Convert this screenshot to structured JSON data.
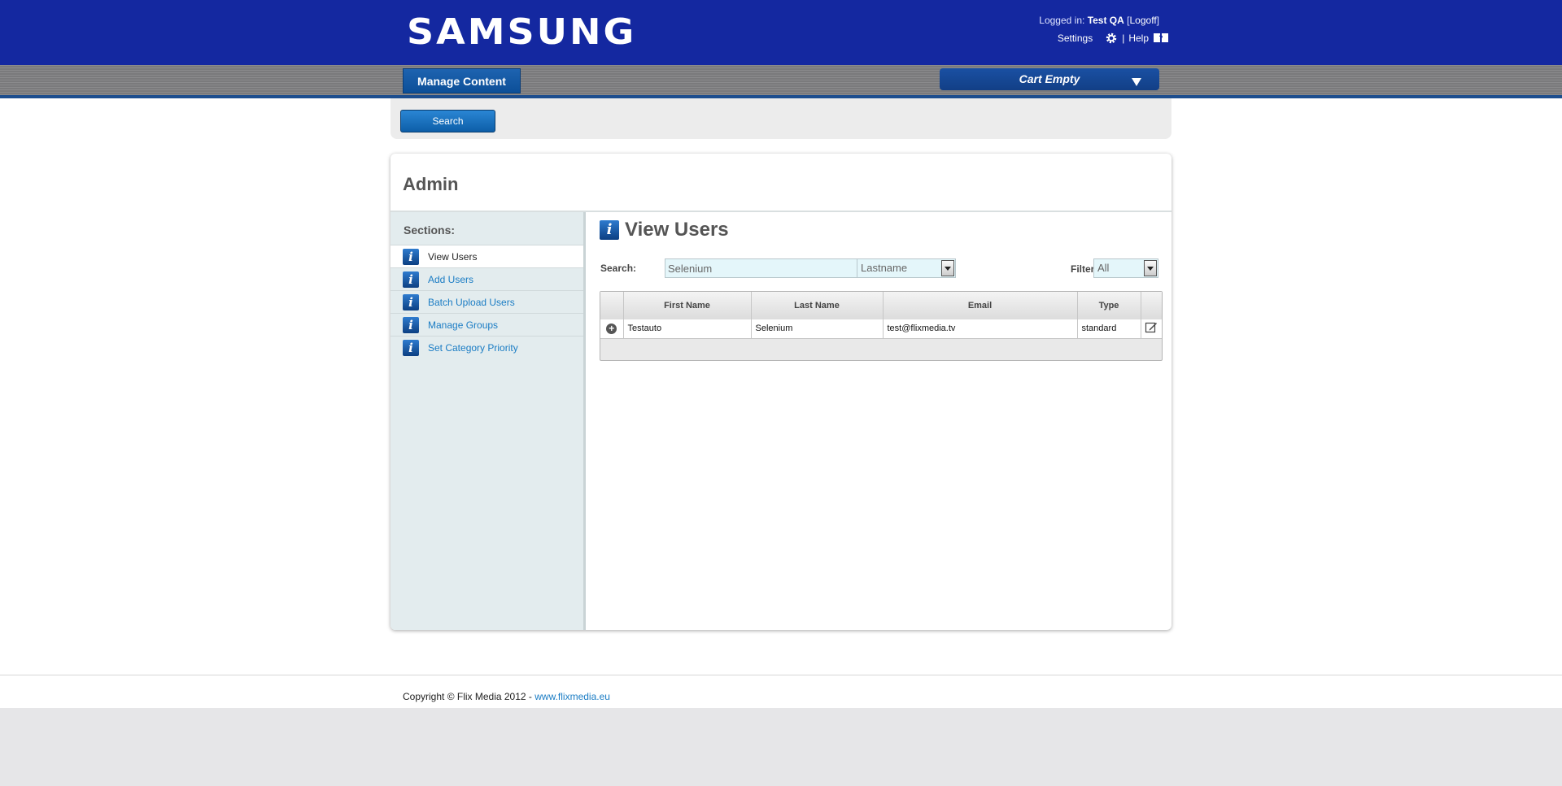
{
  "header": {
    "logo_text": "SAMSUNG",
    "logged_in_prefix": "Logged in:",
    "user_name": "Test QA",
    "logoff_label": "Logoff",
    "settings_label": "Settings",
    "help_label": "Help",
    "brand_color": "#1428a0"
  },
  "nav": {
    "manage_content_label": "Manage Content",
    "cart_label": "Cart Empty"
  },
  "toolbar": {
    "search_button_label": "Search"
  },
  "admin": {
    "title": "Admin",
    "sections_label": "Sections:",
    "sections": [
      {
        "label": "View Users",
        "active": true
      },
      {
        "label": "Add Users",
        "active": false
      },
      {
        "label": "Batch Upload Users",
        "active": false
      },
      {
        "label": "Manage Groups",
        "active": false
      },
      {
        "label": "Set Category Priority",
        "active": false
      }
    ]
  },
  "view_users": {
    "title": "View Users",
    "search_label": "Search:",
    "search_value": "Selenium",
    "search_field_select": "Lastname",
    "filter_label": "Filter",
    "filter_value": "All",
    "columns": [
      "First Name",
      "Last Name",
      "Email",
      "Type"
    ],
    "rows": [
      {
        "first_name": "Testauto",
        "last_name": "Selenium",
        "email": "test@flixmedia.tv",
        "type": "standard"
      }
    ]
  },
  "footer": {
    "copyright": "Copyright © Flix Media 2012 -",
    "link_text": "www.flixmedia.eu",
    "link_color": "#1a7cc4"
  }
}
